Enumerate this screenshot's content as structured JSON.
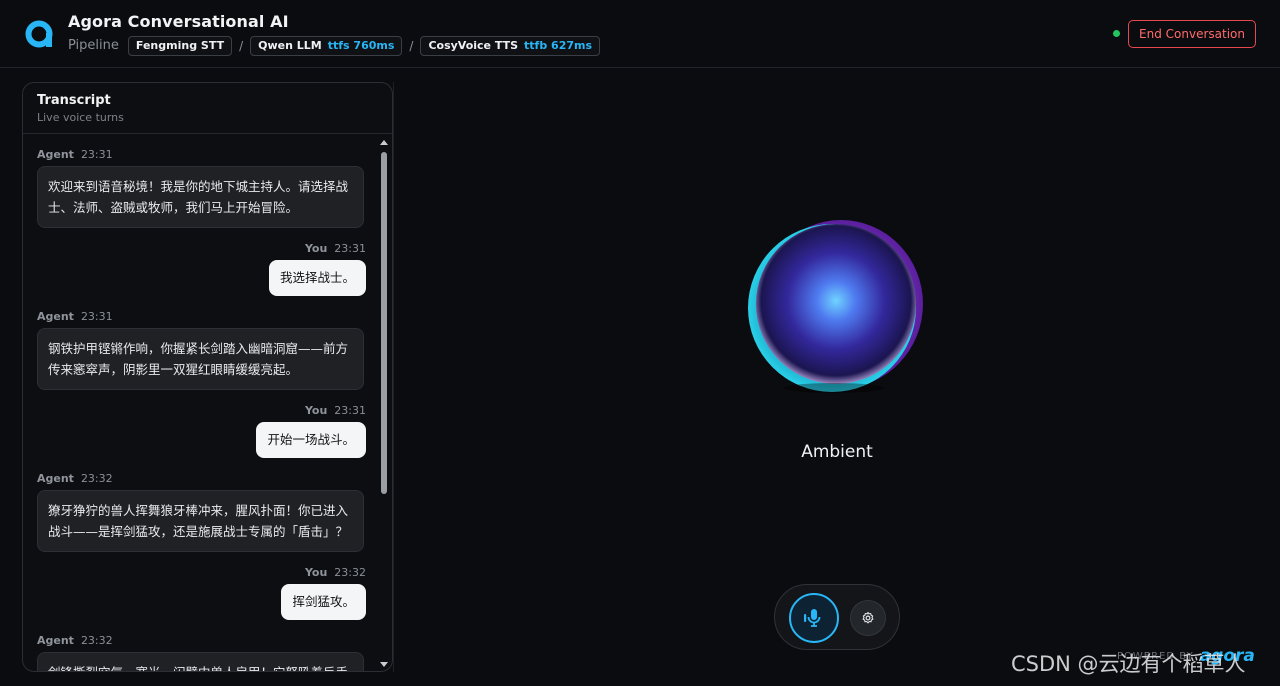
{
  "header": {
    "title": "Agora Conversational AI",
    "pipeline_label": "Pipeline",
    "stages": [
      {
        "name": "Fengming STT",
        "metric": ""
      },
      {
        "name": "Qwen LLM",
        "metric": "ttfs 760ms"
      },
      {
        "name": "CosyVoice TTS",
        "metric": "ttfb 627ms"
      }
    ],
    "separator": "/",
    "end_button": "End Conversation",
    "status_color": "#22c55e",
    "accent_color": "#29b6f6"
  },
  "transcript": {
    "title": "Transcript",
    "subtitle": "Live voice turns",
    "messages": [
      {
        "role": "agent",
        "speaker": "Agent",
        "time": "23:31",
        "text": "欢迎来到语音秘境！我是你的地下城主持人。请选择战士、法师、盗贼或牧师，我们马上开始冒险。"
      },
      {
        "role": "user",
        "speaker": "You",
        "time": "23:31",
        "text": "我选择战士。"
      },
      {
        "role": "agent",
        "speaker": "Agent",
        "time": "23:31",
        "text": "钢铁护甲铿锵作响，你握紧长剑踏入幽暗洞窟——前方传来窸窣声，阴影里一双猩红眼睛缓缓亮起。"
      },
      {
        "role": "user",
        "speaker": "You",
        "time": "23:31",
        "text": "开始一场战斗。"
      },
      {
        "role": "agent",
        "speaker": "Agent",
        "time": "23:32",
        "text": "獠牙狰狞的兽人挥舞狼牙棒冲来，腥风扑面！你已进入战斗——是挥剑猛攻，还是施展战士专属的「盾击」？"
      },
      {
        "role": "user",
        "speaker": "You",
        "time": "23:32",
        "text": "挥剑猛攻。"
      },
      {
        "role": "agent",
        "speaker": "Agent",
        "time": "23:32",
        "text": "剑锋撕裂空气，寒光一闪劈中兽人肩甲！它怒吼着反手"
      }
    ]
  },
  "stage": {
    "status": "Ambient",
    "mic_icon": "mic-icon",
    "settings_icon": "gear-icon"
  },
  "footer": {
    "powered_by": "POWERED BY",
    "brand": "agora"
  },
  "watermark": "CSDN @云边有个稻草人"
}
